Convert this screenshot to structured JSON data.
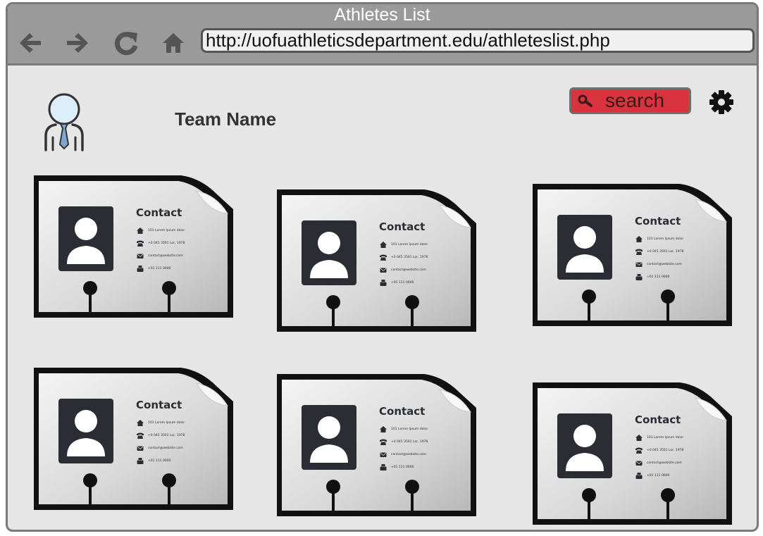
{
  "window": {
    "title": "Athletes List"
  },
  "toolbar": {
    "back_icon": "left-arrow-icon",
    "forward_icon": "right-arrow-icon",
    "reload_icon": "reload-icon",
    "home_icon": "home-icon",
    "url": "http://uofuathleticsdepartment.edu/athleteslist.php"
  },
  "header": {
    "team_name": "Team Name",
    "search_label": "search",
    "search_icon": "search-icon",
    "settings_icon": "gear-icon",
    "avatar_icon": "user-tie-icon"
  },
  "colors": {
    "chrome": "#9a9a9a",
    "page_bg": "#e6e6e6",
    "search_bg": "#d9343e",
    "card_dark": "#2a2d34"
  },
  "cards": [
    {
      "title": "Contact",
      "lines": [
        "101 Lorem Ipsum dolor",
        "+0 045 3501 Lor, 1978",
        "contact@website.com",
        "+01 111 0000"
      ]
    },
    {
      "title": "Contact",
      "lines": [
        "101 Lorem Ipsum dolor",
        "+0 045 3501 Lor, 1978",
        "contact@website.com",
        "+01 111 0000"
      ]
    },
    {
      "title": "Contact",
      "lines": [
        "101 Lorem Ipsum dolor",
        "+0 045 3501 Lor, 1978",
        "contact@website.com",
        "+01 111 0000"
      ]
    },
    {
      "title": "Contact",
      "lines": [
        "101 Lorem Ipsum dolor",
        "+0 045 3501 Lor, 1978",
        "contact@website.com",
        "+01 111 0000"
      ]
    },
    {
      "title": "Contact",
      "lines": [
        "101 Lorem Ipsum dolor",
        "+0 045 3501 Lor, 1978",
        "contact@website.com",
        "+01 111 0000"
      ]
    },
    {
      "title": "Contact",
      "lines": [
        "101 Lorem Ipsum dolor",
        "+0 045 3501 Lor, 1978",
        "contact@website.com",
        "+01 111 0000"
      ]
    }
  ]
}
